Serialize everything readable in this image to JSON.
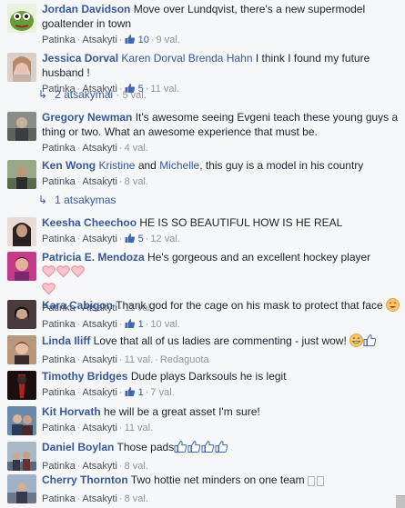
{
  "comments": [
    {
      "author": "Jordan Davidson",
      "text": "Move over Lundqvist, there's a new supermodel goaltender in town",
      "like": "Patinka",
      "reply": "Atsakyti",
      "likes": "10",
      "time": "9 val.",
      "avatar_color": "#6b9a3a"
    },
    {
      "author": "Jessica Dorval",
      "tags": "Karen Dorval Brenda Hahn",
      "text": "I think I found my future husband !",
      "like": "Patinka",
      "reply": "Atsakyti",
      "likes": "5",
      "time": "11 val.",
      "avatar_color": "#b7a6a0"
    },
    {
      "author": "Gregory Newman",
      "text": "It's awesome seeing Evgeni teach these young guys a thing or two. What an awesome experience that must be.",
      "like": "Patinka",
      "reply": "Atsakyti",
      "time": "4 val.",
      "avatar_color": "#7d7f78"
    },
    {
      "author": "Ken Wong",
      "tag1": "Kristine",
      "and": "and",
      "tag2": "Michelle",
      "text": ", this guy is a model in his country",
      "like": "Patinka",
      "reply": "Atsakyti",
      "time": "8 val.",
      "avatar_color": "#6d7d6a"
    },
    {
      "author": "Keesha Cheechoo",
      "text": "HE IS SO BEAUTIFUL HOW IS HE REAL",
      "like": "Patinka",
      "reply": "Atsakyti",
      "likes": "5",
      "time": "12 val.",
      "avatar_color": "#3b3030"
    },
    {
      "author": "Patricia E. Mendoza",
      "text": "He's gorgeous and an excellent hockey player",
      "like": "Patinka",
      "reply": "Atsakyti",
      "time": "11 val.",
      "avatar_color": "#c63a8c"
    },
    {
      "author": "Kara Cabigon",
      "text": "Thank god for the cage on his mask to protect that face",
      "like": "Patinka",
      "reply": "Atsakyti",
      "likes": "1",
      "time": "10 val.",
      "avatar_color": "#5a4a4a"
    },
    {
      "author": "Linda Iliff",
      "text": "Love that all of us ladies are commenting - just wow!",
      "like": "Patinka",
      "reply": "Atsakyti",
      "time": "11 val.",
      "edited": "Redaguota",
      "avatar_color": "#9a6a4a"
    },
    {
      "author": "Timothy Bridges",
      "text": "Dude plays Darksouls he is legit",
      "like": "Patinka",
      "reply": "Atsakyti",
      "likes": "1",
      "time": "7 val.",
      "avatar_color": "#8a2020"
    },
    {
      "author": "Kit Horvath",
      "text": "he will be a great asset I'm sure!",
      "like": "Patinka",
      "reply": "Atsakyti",
      "time": "11 val.",
      "avatar_color": "#4a6a8a"
    },
    {
      "author": "Daniel Boylan",
      "text": "Those pads",
      "like": "Patinka",
      "reply": "Atsakyti",
      "time": "8 val.",
      "avatar_color": "#6a7a8a"
    },
    {
      "author": "Cherry Thornton",
      "text": "Two hottie net minders on one team",
      "like": "Patinka",
      "reply": "Atsakyti",
      "time": "8 val.",
      "avatar_color": "#7a8aa0"
    }
  ],
  "reply_threads": [
    {
      "label": "2 atsakymai",
      "time": "5 val."
    },
    {
      "label": "1 atsakymas"
    }
  ],
  "colors": {
    "link": "#365899",
    "meta": "#90949c",
    "background": "#f6f7f9",
    "heart": "#f28da0"
  }
}
